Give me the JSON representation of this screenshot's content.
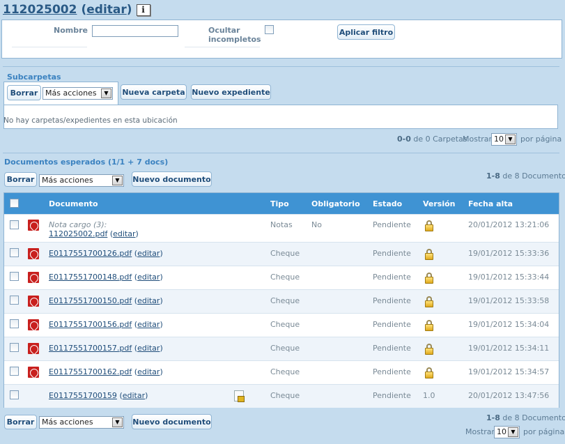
{
  "header": {
    "title": "112025002",
    "edit_label": "editar",
    "open_paren": "(",
    "close_paren": ")",
    "info_glyph": "i"
  },
  "filter": {
    "name_label": "Nombre",
    "name_value": "",
    "hide_incomplete_label_1": "Ocultar",
    "hide_incomplete_label_2": "incompletos",
    "hide_incomplete_checked": false,
    "apply_button": "Aplicar filtro"
  },
  "subfolders": {
    "title": "Subcarpetas",
    "delete_button": "Borrar",
    "actions_select": "Más acciones",
    "new_folder_button": "Nueva carpeta",
    "new_file_button": "Nuevo expediente",
    "empty_message": "No hay carpetas/expedientes en esta ubicación",
    "pager_range": "0-0",
    "pager_text": "de 0 Carpetas",
    "show_label": "Mostrar",
    "per_page_value": "10",
    "per_page_label": "por página"
  },
  "documents": {
    "title": "Documentos esperados (1/1 + 7 docs)",
    "delete_button": "Borrar",
    "actions_select": "Más acciones",
    "new_document_button": "Nuevo documento",
    "pager_range_top": "1-8",
    "pager_text_top": "de 8 Documentos",
    "pager_range_bottom": "1-8",
    "pager_text_bottom": "de 8 Documentos",
    "show_label": "Mostrar",
    "per_page_value": "10",
    "per_page_label": "por página",
    "columns": {
      "document": "Documento",
      "type": "Tipo",
      "mandatory": "Obligatorio",
      "status": "Estado",
      "version": "Versión",
      "created": "Fecha alta"
    },
    "rows": [
      {
        "note": "Nota cargo (3):",
        "file": "112025002.pdf",
        "edit": "editar",
        "type": "Notas",
        "mandatory": "No",
        "status": "Pendiente",
        "version": "",
        "date": "20/01/2012 13:21:06",
        "icon": "pdf-icon",
        "version_icon": "lock-icon"
      },
      {
        "note": "",
        "file": "E0117551700126.pdf",
        "edit": "editar",
        "type": "Cheque",
        "mandatory": "",
        "status": "Pendiente",
        "version": "",
        "date": "19/01/2012 15:33:36",
        "icon": "pdf-icon",
        "version_icon": "lock-icon"
      },
      {
        "note": "",
        "file": "E0117551700148.pdf",
        "edit": "editar",
        "type": "Cheque",
        "mandatory": "",
        "status": "Pendiente",
        "version": "",
        "date": "19/01/2012 15:33:44",
        "icon": "pdf-icon",
        "version_icon": "lock-icon"
      },
      {
        "note": "",
        "file": "E0117551700150.pdf",
        "edit": "editar",
        "type": "Cheque",
        "mandatory": "",
        "status": "Pendiente",
        "version": "",
        "date": "19/01/2012 15:33:58",
        "icon": "pdf-icon",
        "version_icon": "lock-icon"
      },
      {
        "note": "",
        "file": "E0117551700156.pdf",
        "edit": "editar",
        "type": "Cheque",
        "mandatory": "",
        "status": "Pendiente",
        "version": "",
        "date": "19/01/2012 15:34:04",
        "icon": "pdf-icon",
        "version_icon": "lock-icon"
      },
      {
        "note": "",
        "file": "E0117551700157.pdf",
        "edit": "editar",
        "type": "Cheque",
        "mandatory": "",
        "status": "Pendiente",
        "version": "",
        "date": "19/01/2012 15:34:11",
        "icon": "pdf-icon",
        "version_icon": "lock-icon"
      },
      {
        "note": "",
        "file": "E0117551700162.pdf",
        "edit": "editar",
        "type": "Cheque",
        "mandatory": "",
        "status": "Pendiente",
        "version": "",
        "date": "19/01/2012 15:34:57",
        "icon": "pdf-icon",
        "version_icon": "lock-icon"
      },
      {
        "note": "",
        "file": "E0117551700159",
        "edit": "editar",
        "type": "Cheque",
        "mandatory": "",
        "status": "Pendiente",
        "version": "1.0",
        "date": "20/01/2012 13:47:56",
        "icon": "document-lock-icon",
        "version_icon": ""
      }
    ]
  }
}
